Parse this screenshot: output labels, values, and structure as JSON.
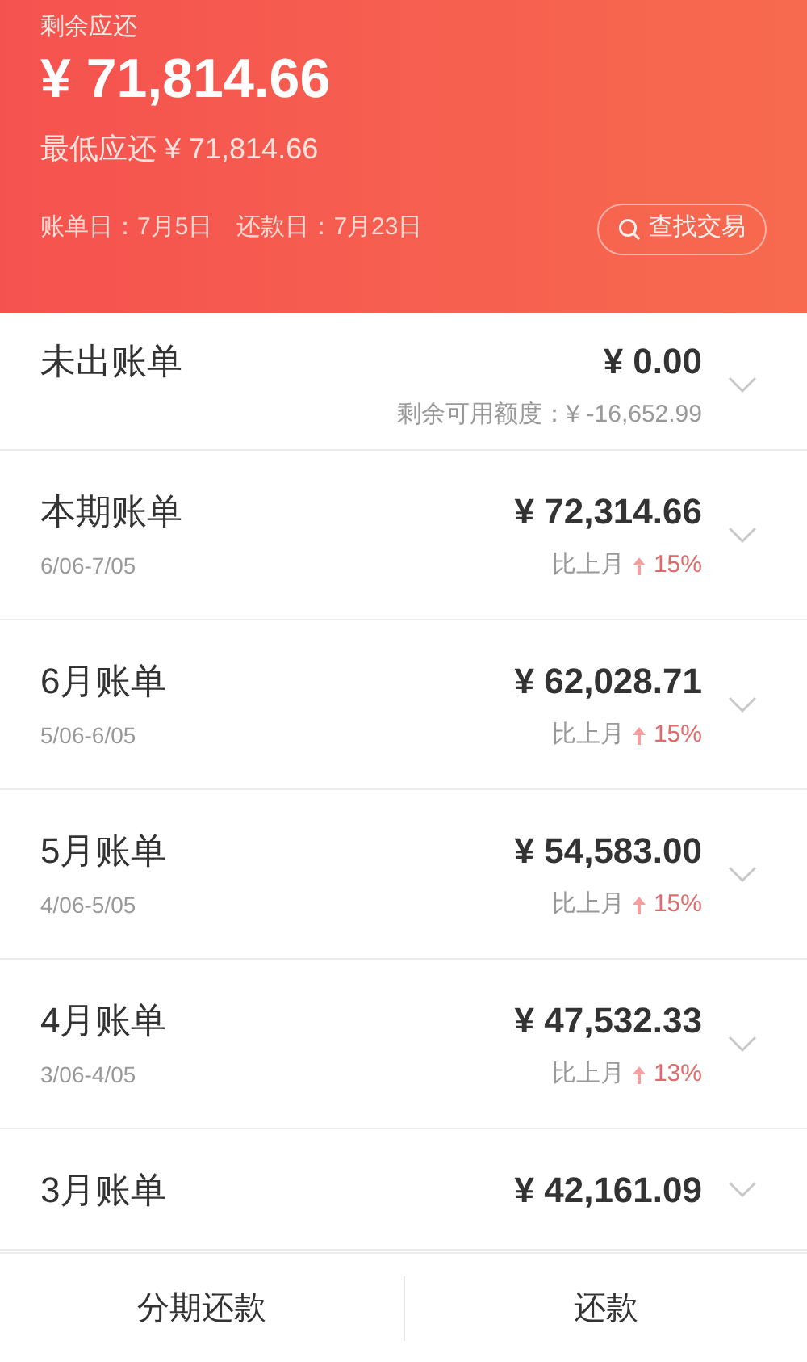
{
  "header": {
    "label": "剩余应还",
    "amount": "¥ 71,814.66",
    "minimum": "最低应还 ¥ 71,814.66",
    "bill_date": "账单日：7月5日",
    "due_date": "还款日：7月23日",
    "search_button": "查找交易"
  },
  "bills": [
    {
      "kind": "unbilled",
      "title": "未出账单",
      "amount": "¥ 0.00",
      "note": "剩余可用额度：¥ -16,652.99"
    },
    {
      "kind": "bill",
      "title": "本期账单",
      "amount": "¥ 72,314.66",
      "period": "6/06-7/05",
      "compare": "比上月",
      "change": "15%"
    },
    {
      "kind": "bill",
      "title": "6月账单",
      "amount": "¥ 62,028.71",
      "period": "5/06-6/05",
      "compare": "比上月",
      "change": "15%"
    },
    {
      "kind": "bill",
      "title": "5月账单",
      "amount": "¥ 54,583.00",
      "period": "4/06-5/05",
      "compare": "比上月",
      "change": "15%"
    },
    {
      "kind": "bill",
      "title": "4月账单",
      "amount": "¥ 47,532.33",
      "period": "3/06-4/05",
      "compare": "比上月",
      "change": "13%"
    },
    {
      "kind": "partial",
      "title": "3月账单",
      "amount": "¥ 42,161.09"
    }
  ],
  "actions": [
    "分期还款",
    "还款"
  ]
}
